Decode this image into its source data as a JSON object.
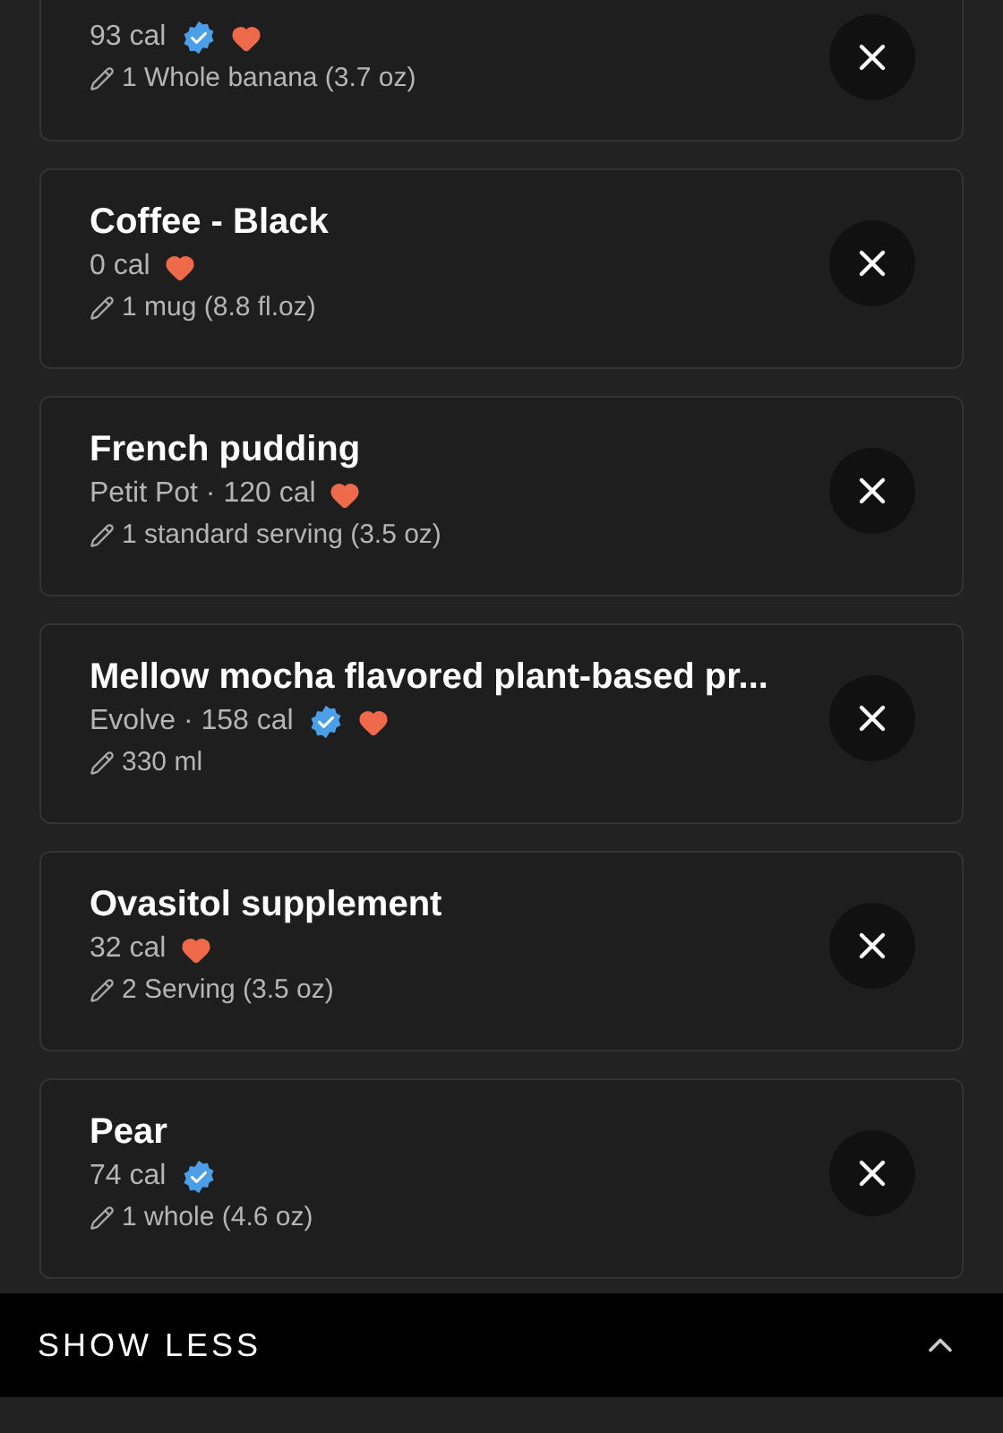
{
  "foods": [
    {
      "subtitle": "93 cal",
      "verified": true,
      "favorite": true,
      "serving": "1 Whole banana (3.7 oz)"
    },
    {
      "name": "Coffee - Black",
      "subtitle": "0 cal",
      "verified": false,
      "favorite": true,
      "serving": "1 mug (8.8 fl.oz)"
    },
    {
      "name": "French pudding",
      "subtitle": "Petit Pot · 120 cal",
      "verified": false,
      "favorite": true,
      "serving": "1 standard serving (3.5 oz)"
    },
    {
      "name": "Mellow mocha flavored plant-based pr...",
      "subtitle": "Evolve · 158 cal",
      "verified": true,
      "favorite": true,
      "serving": "330 ml"
    },
    {
      "name": "Ovasitol supplement",
      "subtitle": "32 cal",
      "verified": false,
      "favorite": true,
      "serving": "2 Serving (3.5 oz)"
    },
    {
      "name": "Pear",
      "subtitle": "74 cal",
      "verified": true,
      "favorite": false,
      "serving": "1 whole (4.6 oz)"
    }
  ],
  "toggle": {
    "label": "SHOW LESS",
    "expanded": true
  }
}
